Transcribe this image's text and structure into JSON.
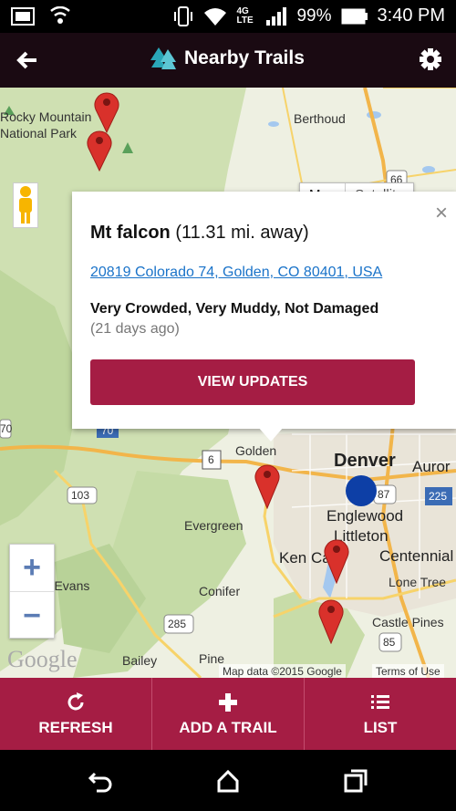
{
  "status": {
    "network": "4G LTE",
    "battery": "99%",
    "time": "3:40 PM"
  },
  "app_bar": {
    "title": "Nearby Trails"
  },
  "map": {
    "map_type_options": [
      "Map",
      "Satellite"
    ],
    "labels": {
      "rocky_mountain": "Rocky Mountain",
      "national_park": "National Park",
      "berthoud": "Berthoud",
      "golden": "Golden",
      "denver": "Denver",
      "aurora": "Auror",
      "englewood": "Englewood",
      "littleton": "Littleton",
      "ken_caryl": "Ken Ca",
      "centennial": "Centennial",
      "lone_tree": "Lone Tree",
      "evergreen": "Evergreen",
      "mt_evans": "Mt Evans",
      "conifer": "Conifer",
      "castle_pines": "Castle Pines",
      "bailey": "Bailey",
      "pine": "Pine",
      "hwy_66": "66",
      "hwy_70": "70",
      "hwy_6": "6",
      "hwy_103": "103",
      "hwy_87": "87",
      "hwy_225": "225",
      "hwy_285": "285",
      "hwy_85": "85",
      "hwy_70_left": "70"
    },
    "zoom_in": "+",
    "zoom_out": "−",
    "google": "Google",
    "credit": "Map data ©2015 Google",
    "terms": "Terms of Use"
  },
  "popup": {
    "trail_name": "Mt falcon",
    "distance": " (11.31 mi. away)",
    "address": "20819 Colorado 74, Golden, CO 80401, USA",
    "conditions": "Very Crowded, Very Muddy, Not Damaged",
    "age": "(21 days ago)",
    "button": "VIEW UPDATES",
    "close": "×"
  },
  "actions": [
    {
      "label": "REFRESH",
      "icon": "refresh-icon"
    },
    {
      "label": "ADD A TRAIL",
      "icon": "plus-icon"
    },
    {
      "label": "LIST",
      "icon": "list-icon"
    }
  ],
  "colors": {
    "brand": "#a51d44",
    "app_bar": "#1a0a12",
    "pin": "#d9312b",
    "location_dot": "#0d3fa6",
    "link": "#1a73c9"
  }
}
